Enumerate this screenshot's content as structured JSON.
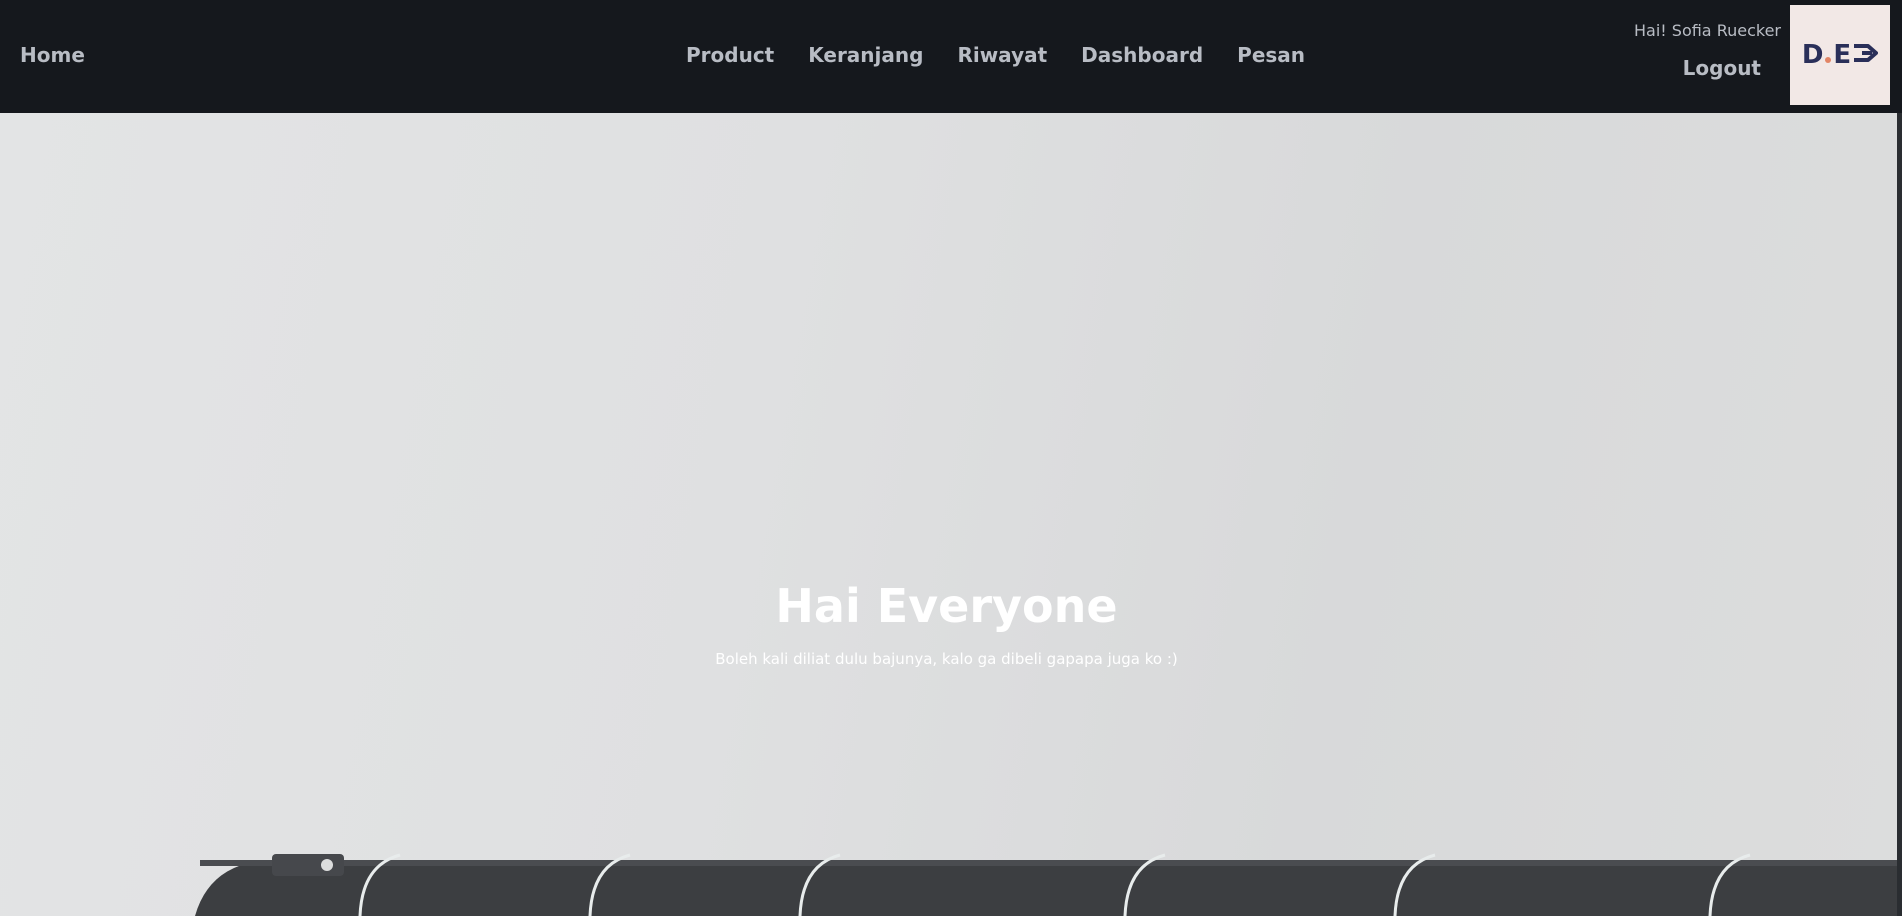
{
  "nav": {
    "home_label": "Home",
    "links": [
      "Product",
      "Keranjang",
      "Riwayat",
      "Dashboard",
      "Pesan"
    ],
    "greeting": "Hai! Sofia Ruecker",
    "logout_label": "Logout",
    "logo_text": "D.E"
  },
  "hero": {
    "title": "Hai Everyone",
    "subtitle": "Boleh kali diliat dulu bajunya, kalo ga dibeli gapapa juga ko :)"
  },
  "colors": {
    "navbar_bg": "#15181d",
    "nav_text": "#b8bcc4",
    "logo_bg": "#f2e8e6",
    "logo_navy": "#2a2f59",
    "logo_accent": "#e28566",
    "rail": "#3c3e41"
  }
}
